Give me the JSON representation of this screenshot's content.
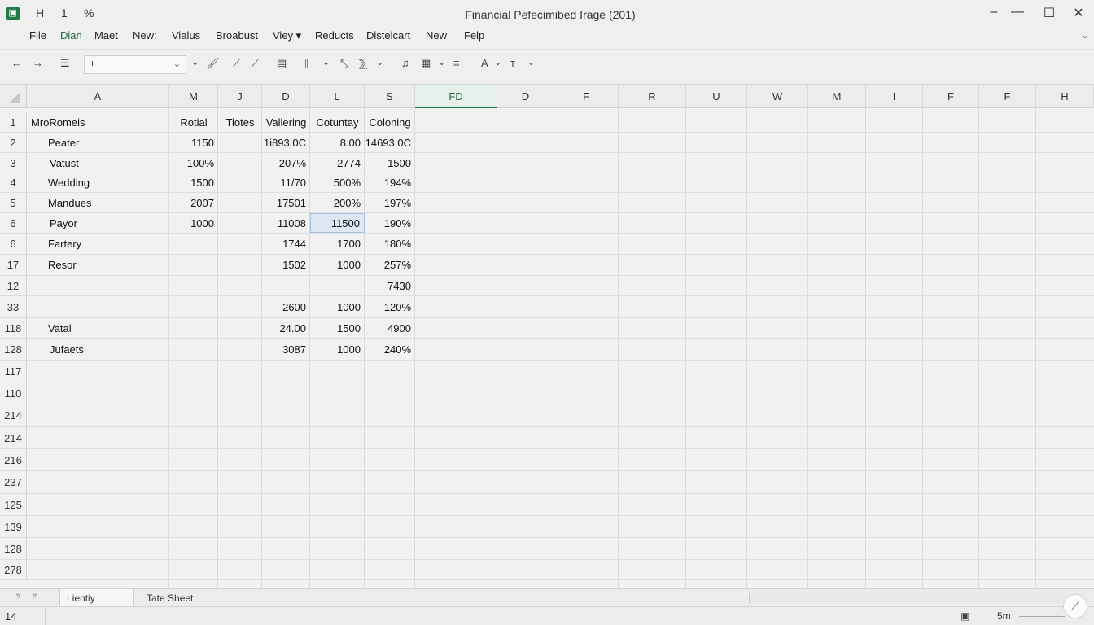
{
  "window": {
    "title": "Financial Pefecimibed Irage (201)",
    "quick_access": [
      "H",
      "1",
      "%"
    ],
    "app_icon": "spreadsheet-app-icon",
    "controls": {
      "minimize": "–",
      "restore": "—",
      "maximize": "☐",
      "close": "✕"
    }
  },
  "menu": {
    "items": [
      "File",
      "Dian",
      "Maet",
      "New:",
      "Vialus",
      "Broabust",
      "Viey ▾",
      "Reducts",
      "Distelcart",
      "New",
      "Felp"
    ],
    "active_index": 1,
    "expand": "⌄"
  },
  "toolbar": {
    "namebox_value": "ı",
    "icons": [
      "←",
      "→",
      "☰",
      "⌄",
      "🖌",
      "⟋",
      "⟋",
      "▤",
      "⟦",
      "⌄",
      "⤡",
      "⅀",
      "⌄",
      "♫",
      "▦",
      "⌄",
      "≡",
      "A",
      "⌄",
      "ᴛ",
      "⌄"
    ]
  },
  "grid": {
    "column_headers": [
      "A",
      "M",
      "J",
      "D",
      "L",
      "S",
      "FD",
      "D",
      "F",
      "R",
      "U",
      "W",
      "M",
      "I",
      "F",
      "F",
      "H"
    ],
    "active_column_index": 6,
    "rows": [
      {
        "num": "1",
        "cells": [
          "MroRomeis",
          "Rotial",
          "Tiotes",
          "Vallering",
          "Cotuntay",
          "Coloning"
        ],
        "header": true
      },
      {
        "num": "2",
        "cells": [
          "Peater",
          "1150",
          "",
          "1i893.0C",
          "8.00",
          "14693.0C"
        ]
      },
      {
        "num": "3",
        "cells": [
          "Vatust",
          "100%",
          "",
          "207%",
          "2774",
          "1500"
        ]
      },
      {
        "num": "4",
        "cells": [
          "Wedding",
          "1500",
          "",
          "11/70",
          "500%",
          "194%"
        ]
      },
      {
        "num": "5",
        "cells": [
          "Mandues",
          "2007",
          "",
          "17501",
          "200%",
          "197%"
        ]
      },
      {
        "num": "6",
        "cells": [
          "Payor",
          "1000",
          "",
          "11008",
          "11500",
          "190%"
        ],
        "selected_col": 4
      },
      {
        "num": "6",
        "cells": [
          "Fartery",
          "",
          "",
          "1744",
          "1700",
          "180%"
        ]
      },
      {
        "num": "17",
        "cells": [
          "Resor",
          "",
          "",
          "1502",
          "1000",
          "257%"
        ]
      },
      {
        "num": "12",
        "cells": [
          "",
          "",
          "",
          "",
          "",
          "7430"
        ]
      },
      {
        "num": "33",
        "cells": [
          "",
          "",
          "",
          "2600",
          "1000",
          "120%"
        ]
      },
      {
        "num": "118",
        "cells": [
          "Vatal",
          "",
          "",
          "24.00",
          "1500",
          "4900"
        ]
      },
      {
        "num": "128",
        "cells": [
          "Jufaets",
          "",
          "",
          "3087",
          "1000",
          "240%"
        ]
      },
      {
        "num": "117",
        "cells": []
      },
      {
        "num": "110",
        "cells": []
      },
      {
        "num": "214",
        "cells": []
      },
      {
        "num": "214",
        "cells": []
      },
      {
        "num": "216",
        "cells": []
      },
      {
        "num": "237",
        "cells": []
      },
      {
        "num": "125",
        "cells": []
      },
      {
        "num": "139",
        "cells": []
      },
      {
        "num": "128",
        "cells": []
      },
      {
        "num": "278",
        "cells": []
      }
    ]
  },
  "sheets": {
    "tabs": [
      "Lientiy",
      "Tate Sheet"
    ],
    "active_index": 0,
    "nav": [
      "▿",
      "▿"
    ]
  },
  "status": {
    "cell_ref": "14",
    "view_icon": "page-layout-icon",
    "zoom": "5m",
    "fab_icon": "⟋"
  },
  "colors": {
    "accent": "#1e7a45",
    "selection": "#dfe7f3"
  }
}
